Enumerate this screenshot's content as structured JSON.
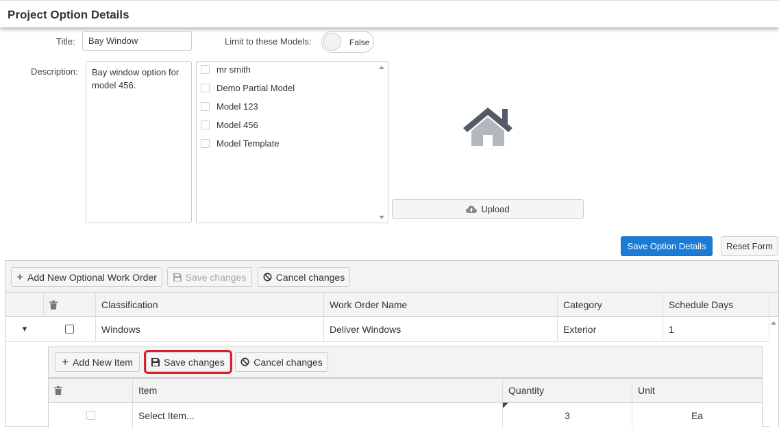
{
  "header": {
    "title": "Project Option Details"
  },
  "form": {
    "title_label": "Title:",
    "title_value": "Bay Window",
    "limit_label": "Limit to these Models:",
    "limit_toggle_value": "False",
    "description_label": "Description:",
    "description_value": "Bay window option for model 456."
  },
  "models": [
    {
      "label": "mr smith"
    },
    {
      "label": "Demo Partial Model"
    },
    {
      "label": "Model 123"
    },
    {
      "label": "Model 456"
    },
    {
      "label": "Model Template"
    }
  ],
  "image_panel": {
    "icon": "house-icon",
    "upload_label": "Upload"
  },
  "actions": {
    "save_label": "Save Option Details",
    "reset_label": "Reset Form"
  },
  "work_orders": {
    "toolbar": {
      "add_label": "Add New Optional Work Order",
      "save_label": "Save changes",
      "cancel_label": "Cancel changes"
    },
    "columns": [
      "Classification",
      "Work Order Name",
      "Category",
      "Schedule Days"
    ],
    "rows": [
      {
        "classification": "Windows",
        "name": "Deliver Windows",
        "category": "Exterior",
        "schedule_days": "1"
      }
    ]
  },
  "items": {
    "toolbar": {
      "add_label": "Add New Item",
      "save_label": "Save changes",
      "cancel_label": "Cancel changes"
    },
    "columns": [
      "Item",
      "Quantity",
      "Unit"
    ],
    "rows": [
      {
        "item": "Select Item...",
        "quantity": "3",
        "unit": "Ea"
      }
    ]
  },
  "colors": {
    "primary": "#1c7cd5",
    "highlight": "#d9202a",
    "house": "#555b66"
  }
}
